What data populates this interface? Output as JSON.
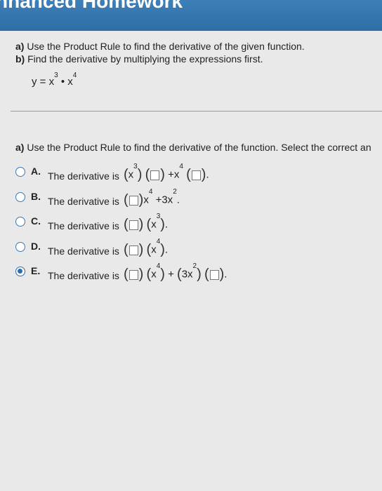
{
  "header": {
    "title": "nhanced Homework"
  },
  "instructions": {
    "a_label": "a)",
    "a_text": " Use the Product Rule to find the derivative of the given function.",
    "b_label": "b)",
    "b_text": " Find the derivative by multiplying the expressions first."
  },
  "given": {
    "lhs": "y = x",
    "exp1": "3",
    "middle": " • x",
    "exp2": "4"
  },
  "question": {
    "label": "a)",
    "text": " Use the Product Rule to find the derivative of the function. Select the correct an"
  },
  "options": [
    {
      "letter": "A.",
      "text": "The derivative is",
      "selected": false
    },
    {
      "letter": "B.",
      "text": "The derivative is",
      "selected": false
    },
    {
      "letter": "C.",
      "text": "The derivative is",
      "selected": false
    },
    {
      "letter": "D.",
      "text": "The derivative is",
      "selected": false
    },
    {
      "letter": "E.",
      "text": "The derivative is",
      "selected": true
    }
  ],
  "math": {
    "x": "x",
    "three": "3",
    "four": "4",
    "plus": "+",
    "period": ".",
    "three_x": "3x",
    "two": "2"
  },
  "colors": {
    "header_blue": "#2f6ea6",
    "radio_blue": "#2e6dab"
  }
}
